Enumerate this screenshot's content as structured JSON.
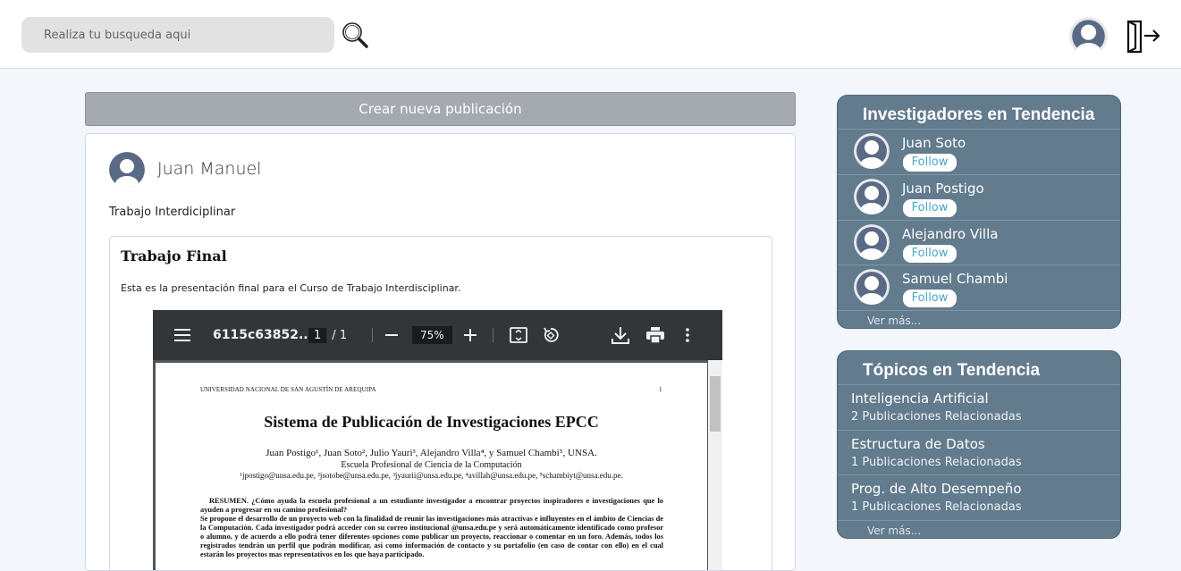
{
  "search": {
    "placeholder": "Realiza tu busqueda aqui"
  },
  "feed": {
    "create_label": "Crear nueva publicación",
    "post": {
      "author": "Juan Manuel",
      "subject": "Trabajo Interdiciplinar",
      "title": "Trabajo Final",
      "description": "Esta es la presentación final para el Curso de Trabajo Interdisciplinar.",
      "pdf": {
        "filename": "6115c63852...",
        "page_current": "1",
        "page_sep": "/",
        "page_total": "1",
        "zoom": "75%",
        "header_left": "UNIVERSIDAD NACIONAL DE SAN AGUSTÍN DE AREQUIPA",
        "header_page": "1",
        "title": "Sistema de Publicación de Investigaciones EPCC",
        "authors": "Juan Postigo¹, Juan Soto², Julio Yauri³, Alejandro Villa⁴, y Samuel Chambi⁵, UNSA.",
        "school": "Escuela Profesional de Ciencia de la Computación",
        "emails": "¹jpostigo@unsa.edu.pe, ²jsotobe@unsa.edu.pe, ³jyaurii@unsa.edu.pe, ⁴avillah@unsa.edu.pe, ⁵schambiyt@unsa.edu.pe.",
        "abstract": [
          "RESUMEN. ¿Cómo ayuda la escuela profesional a un estudiante investigador a encontrar proyectos inspiradores e investigaciones que lo ayuden a progresar en su camino profesional?",
          "Se propone el desarrollo de un proyecto web con la finalidad de reunir las investigaciones más atractivas e influyentes en el ámbito de Ciencias de la Computación. Cada investigador podrá acceder con su correo institucional @unsa.edu.pe y será automáticamente identificado como profesor o alumno, y de acuerdo a ello podrá tener diferentes opciones como publicar un proyecto, reaccionar o comentar en un foro. Además, todos los registrados tendrán un perfil que podrán modificar, así como información de contacto y su portafolio (en caso de contar con ello) en el cual estarán los proyectos mas representativos en los que haya participado."
        ]
      }
    }
  },
  "researchers": {
    "title": "Investigadores en Tendencia",
    "follow_label": "Follow",
    "items": [
      {
        "name": "Juan Soto"
      },
      {
        "name": "Juan Postigo"
      },
      {
        "name": "Alejandro Villa"
      },
      {
        "name": "Samuel Chambi"
      }
    ],
    "more": "Ver más..."
  },
  "topics": {
    "title": "Tópicos en Tendencia",
    "items": [
      {
        "name": "Inteligencia Artificial",
        "count": "2 Publicaciones Relacionadas"
      },
      {
        "name": "Estructura de Datos",
        "count": "1 Publicaciones Relacionadas"
      },
      {
        "name": "Prog. de Alto Desempeño",
        "count": "1 Publicaciones Relacionadas"
      }
    ],
    "more": "Ver más..."
  },
  "colors": {
    "panel": "#627b8d",
    "accent": "#4aa6c9",
    "create_button": "#a5a9b0",
    "pdf_toolbar": "#323639"
  },
  "icons": {
    "search": "magnifier-icon",
    "logout": "logout-icon",
    "avatar": "user-avatar-icon"
  }
}
